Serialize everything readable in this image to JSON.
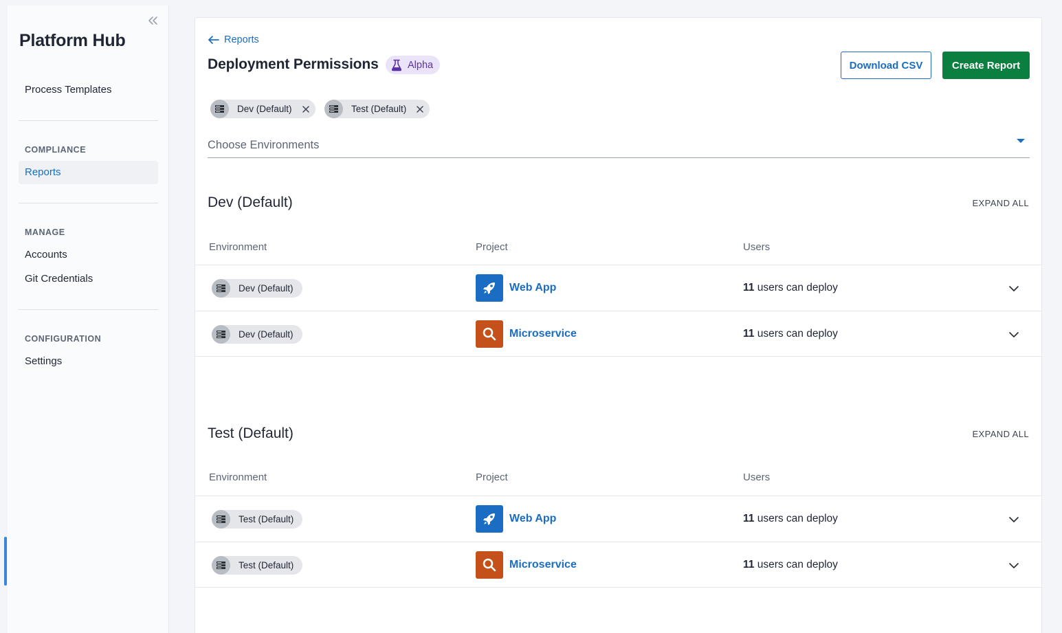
{
  "sidebar": {
    "brand": "Platform Hub",
    "items": [
      {
        "label": "Process Templates"
      },
      {
        "label": "Reports"
      },
      {
        "label": "Accounts"
      },
      {
        "label": "Git Credentials"
      },
      {
        "label": "Settings"
      }
    ],
    "headings": [
      "COMPLIANCE",
      "MANAGE",
      "CONFIGURATION"
    ]
  },
  "header": {
    "back_label": "Reports",
    "title": "Deployment Permissions",
    "badge": "Alpha",
    "download_label": "Download CSV",
    "create_label": "Create Report"
  },
  "filter": {
    "chips": [
      {
        "label": "Dev (Default)"
      },
      {
        "label": "Test (Default)"
      }
    ],
    "placeholder": "Choose Environments"
  },
  "columns": {
    "environment": "Environment",
    "project": "Project",
    "users": "Users"
  },
  "expand_all_label": "EXPAND ALL",
  "sections": [
    {
      "title": "Dev (Default)",
      "rows": [
        {
          "environment": "Dev (Default)",
          "project": "Web App",
          "project_icon": "rocket-icon",
          "project_color": "#1a6dc2",
          "user_count": "11",
          "user_text": "users can deploy"
        },
        {
          "environment": "Dev (Default)",
          "project": "Microservice",
          "project_icon": "search-icon",
          "project_color": "#c4511a",
          "user_count": "11",
          "user_text": "users can deploy"
        }
      ]
    },
    {
      "title": "Test (Default)",
      "rows": [
        {
          "environment": "Test (Default)",
          "project": "Web App",
          "project_icon": "rocket-icon",
          "project_color": "#1a6dc2",
          "user_count": "11",
          "user_text": "users can deploy"
        },
        {
          "environment": "Test (Default)",
          "project": "Microservice",
          "project_icon": "search-icon",
          "project_color": "#c4511a",
          "user_count": "11",
          "user_text": "users can deploy"
        }
      ]
    }
  ],
  "colors": {
    "accent": "#1a6dc2",
    "primary_button": "#0b7f3f",
    "badge_bg": "#ebe3fa",
    "badge_text": "#5a32a3"
  }
}
